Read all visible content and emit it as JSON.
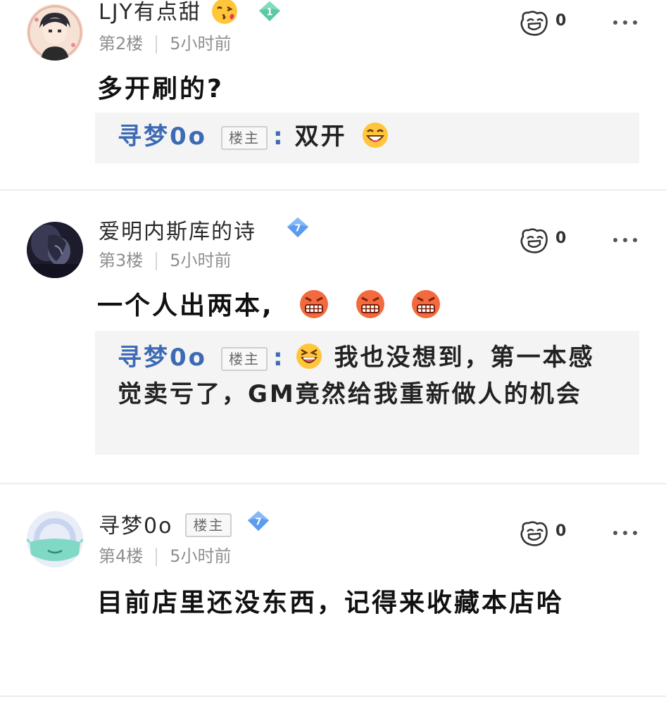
{
  "posts": [
    {
      "username": "LJY有点甜",
      "level": "1",
      "level_color": "#5cc8a5",
      "floor": "第2楼",
      "time": "5小时前",
      "likes": "0",
      "content": "多开刷的?",
      "reply": {
        "name": "寻梦0o",
        "owner_badge": "楼主",
        "colon": ":",
        "text": "双开"
      }
    },
    {
      "username": "爱明内斯库的诗",
      "level": "7",
      "level_color": "#5b9bf0",
      "floor": "第3楼",
      "time": "5小时前",
      "likes": "0",
      "content": "一个人出两本,",
      "reply": {
        "name": "寻梦0o",
        "owner_badge": "楼主",
        "colon": ":",
        "text": "我也没想到，第一本感觉卖亏了，GM竟然给我重新做人的机会"
      }
    },
    {
      "username": "寻梦0o",
      "owner_badge": "楼主",
      "level": "7",
      "level_color": "#5b9bf0",
      "floor": "第4楼",
      "time": "5小时前",
      "likes": "0",
      "content": "目前店里还没东西，记得来收藏本店哈"
    }
  ],
  "icons": {
    "like": "thumbs-up-face-icon",
    "more": "more-dots-icon",
    "level": "diamond-level-icon"
  }
}
